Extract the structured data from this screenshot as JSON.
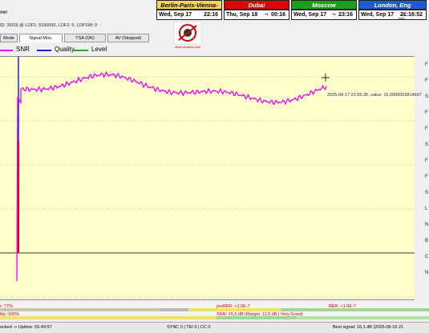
{
  "header": {
    "mode_tab": "Mode",
    "partial_name": "ner",
    "info_line": "ID: 3520) @ LOF1: 5150000, LOF2: 0, LOFSW: 0"
  },
  "logo": {
    "text": "www.dxsatcs.com"
  },
  "clocks": [
    {
      "title": "Berlin-Paris-Vienna-Roma",
      "day": "Wed, Sep 17",
      "time": "22:16",
      "offset": "",
      "title_bg": "#ffd84a"
    },
    {
      "title": "Dubai",
      "day": "Thu, Sep 18",
      "time": "00:16",
      "offset": "+2",
      "title_bg": "#e00000"
    },
    {
      "title": "Moscow",
      "day": "Wed, Sep 17",
      "time": "23:16",
      "offset": "+1",
      "title_bg": "#18a018"
    },
    {
      "title": "London, Eng",
      "day": "Wed, Sep 17",
      "time": "21:16:52",
      "offset": "-1",
      "extra": "DST",
      "title_bg": "#1e5ad8"
    }
  ],
  "tabs": [
    "Mode",
    "Signal Mon.",
    "TSA (OK)",
    "AV (Stopped)"
  ],
  "legend": [
    {
      "label": "SNR",
      "color": "#ee00ee"
    },
    {
      "label": "Quality",
      "color": "#2020c8"
    },
    {
      "label": "Level",
      "color": "#20b020"
    }
  ],
  "tooltip": "2025-09-17 22:05:35, value: 15,6000003814697",
  "side_labels": [
    "F",
    "F",
    "S",
    "F",
    "F",
    "S",
    "F",
    "F",
    "S",
    "L",
    "N",
    "B",
    "C",
    "N"
  ],
  "bars": {
    "left_label": "r: 77%",
    "prober": "preBER: <1.0E-7",
    "ber": "BER: <1.0E-7",
    "quality": "lity: 100%",
    "snr": "SNR: 15,5 dB (Margin: 11,5 dB | Very Good)"
  },
  "status": {
    "locked": "ocked -> Uptime: 55:49:57",
    "sync": "SYNC 0 | TEI 0 | CC 0",
    "best": "Best signal: 16,1 dB (2025-09-16 21"
  }
}
